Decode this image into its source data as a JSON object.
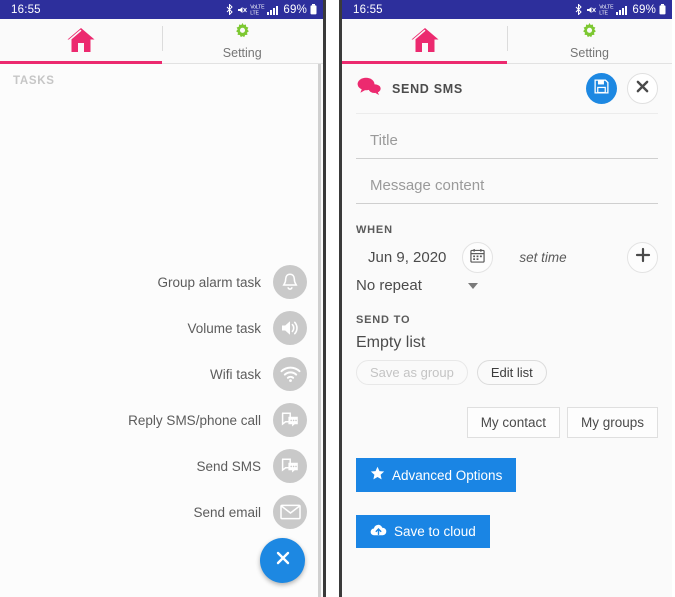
{
  "statusbar": {
    "time": "16:55",
    "bluetooth_icon": "bluetooth-icon",
    "mute_icon": "mute-icon",
    "volte_line1": "VoLTE",
    "volte_line2": "LTE",
    "signal_line1": "R",
    "signal_icon": "signal-bars-icon",
    "battery_pct": "69%",
    "battery_icon": "battery-icon"
  },
  "tabs": [
    {
      "name": "home",
      "label": "",
      "icon": "home-icon",
      "active": true
    },
    {
      "name": "setting",
      "label": "Setting",
      "icon": "gear-icon",
      "active": false
    }
  ],
  "left_panel": {
    "section_label": "TASKS",
    "tasks": [
      {
        "label": "Group alarm task",
        "icon": "bell-icon"
      },
      {
        "label": "Volume task",
        "icon": "speaker-icon"
      },
      {
        "label": "Wifi task",
        "icon": "wifi-icon"
      },
      {
        "label": "Reply SMS/phone call",
        "icon": "reply-message-icon"
      },
      {
        "label": "Send SMS",
        "icon": "message-icon"
      },
      {
        "label": "Send email",
        "icon": "envelope-icon"
      }
    ],
    "fab": {
      "icon": "close-icon"
    }
  },
  "right_panel": {
    "sheet_title": "SEND SMS",
    "sheet_icon": "chat-bubbles-icon",
    "save_button": {
      "icon": "floppy-save-icon"
    },
    "close_button": {
      "icon": "close-icon"
    },
    "title_field": {
      "placeholder": "Title",
      "value": ""
    },
    "message_field": {
      "placeholder": "Message content",
      "value": ""
    },
    "when": {
      "label": "WHEN",
      "date": "Jun 9, 2020",
      "calendar_icon": "calendar-icon",
      "set_time": "set time",
      "add_icon": "plus-icon",
      "repeat": "No repeat",
      "repeat_caret": "chevron-down-icon"
    },
    "send_to": {
      "label": "SEND TO",
      "list_status": "Empty list",
      "save_as_group": "Save as group",
      "edit_list": "Edit list"
    },
    "my_contact": "My contact",
    "my_groups": "My groups",
    "advanced_options": {
      "label": "Advanced Options",
      "icon": "star-icon"
    },
    "save_to_cloud": {
      "label": "Save to cloud",
      "icon": "cloud-upload-icon"
    }
  },
  "colors": {
    "statusbar": "#2d2f9c",
    "accent_pink": "#ec2a6f",
    "accent_blue": "#1a85e4",
    "gear_green": "#7dc832",
    "task_icon_gray": "#c9c9c9"
  }
}
